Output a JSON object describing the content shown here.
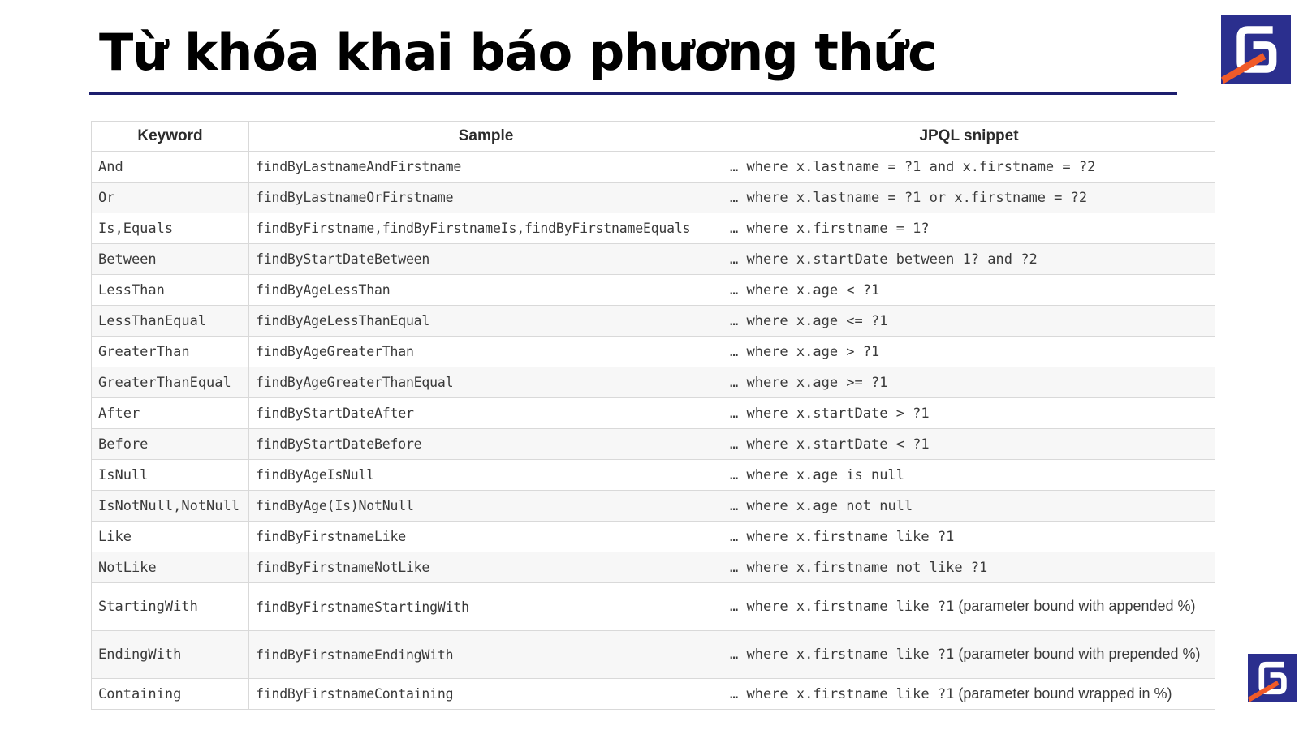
{
  "slide": {
    "title": "Từ khóa khai báo phương thức",
    "logo_icon": "brand-logo-icon",
    "accent_color": "#1c1e6e",
    "logo_color": "#2b2f8e",
    "logo_stripe_color": "#f05a28"
  },
  "table": {
    "headers": {
      "keyword": "Keyword",
      "sample": "Sample",
      "snippet": "JPQL snippet"
    },
    "rows": [
      {
        "keyword": "And",
        "sample": "findByLastnameAndFirstname",
        "snippet": "… where x.lastname = ?1 and x.firstname = ?2",
        "note": ""
      },
      {
        "keyword": "Or",
        "sample": "findByLastnameOrFirstname",
        "snippet": "… where x.lastname = ?1 or x.firstname = ?2",
        "note": ""
      },
      {
        "keyword": "Is,Equals",
        "sample": "findByFirstname,findByFirstnameIs,findByFirstnameEquals",
        "snippet": "… where x.firstname = 1?",
        "note": ""
      },
      {
        "keyword": "Between",
        "sample": "findByStartDateBetween",
        "snippet": "… where x.startDate between 1? and ?2",
        "note": ""
      },
      {
        "keyword": "LessThan",
        "sample": "findByAgeLessThan",
        "snippet": "… where x.age < ?1",
        "note": ""
      },
      {
        "keyword": "LessThanEqual",
        "sample": "findByAgeLessThanEqual",
        "snippet": "… where x.age <= ?1",
        "note": ""
      },
      {
        "keyword": "GreaterThan",
        "sample": "findByAgeGreaterThan",
        "snippet": "… where x.age > ?1",
        "note": ""
      },
      {
        "keyword": "GreaterThanEqual",
        "sample": "findByAgeGreaterThanEqual",
        "snippet": "… where x.age >= ?1",
        "note": ""
      },
      {
        "keyword": "After",
        "sample": "findByStartDateAfter",
        "snippet": "… where x.startDate > ?1",
        "note": ""
      },
      {
        "keyword": "Before",
        "sample": "findByStartDateBefore",
        "snippet": "… where x.startDate < ?1",
        "note": ""
      },
      {
        "keyword": "IsNull",
        "sample": "findByAgeIsNull",
        "snippet": "… where x.age is null",
        "note": ""
      },
      {
        "keyword": "IsNotNull,NotNull",
        "sample": "findByAge(Is)NotNull",
        "snippet": "… where x.age not null",
        "note": ""
      },
      {
        "keyword": "Like",
        "sample": "findByFirstnameLike",
        "snippet": "… where x.firstname like ?1",
        "note": ""
      },
      {
        "keyword": "NotLike",
        "sample": "findByFirstnameNotLike",
        "snippet": "… where x.firstname not like ?1",
        "note": ""
      },
      {
        "keyword": "StartingWith",
        "sample": "findByFirstnameStartingWith",
        "snippet": "… where x.firstname like ?1",
        "note": " (parameter bound with appended %)"
      },
      {
        "keyword": "EndingWith",
        "sample": "findByFirstnameEndingWith",
        "snippet": "… where x.firstname like ?1",
        "note": " (parameter bound with prepended %)"
      },
      {
        "keyword": "Containing",
        "sample": "findByFirstnameContaining",
        "snippet": "… where x.firstname like ?1",
        "note": " (parameter bound wrapped in %)"
      }
    ]
  }
}
